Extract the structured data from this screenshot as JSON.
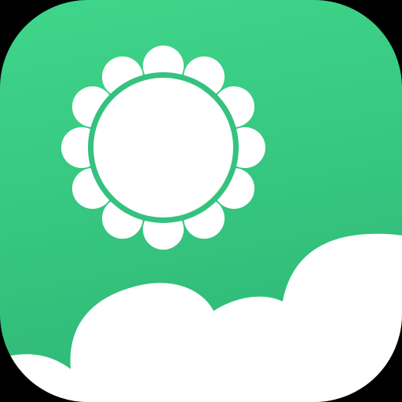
{
  "icon": {
    "name": "weather-app-icon",
    "elements": {
      "sun": "sun-icon",
      "cloud": "cloud-icon"
    }
  },
  "colors": {
    "background": "#000000",
    "tile_top": "#3fd68a",
    "tile_bottom": "#2fb977",
    "sun": "#ffffff",
    "sun_ring": "#35c27f",
    "cloud": "#ffffff"
  }
}
